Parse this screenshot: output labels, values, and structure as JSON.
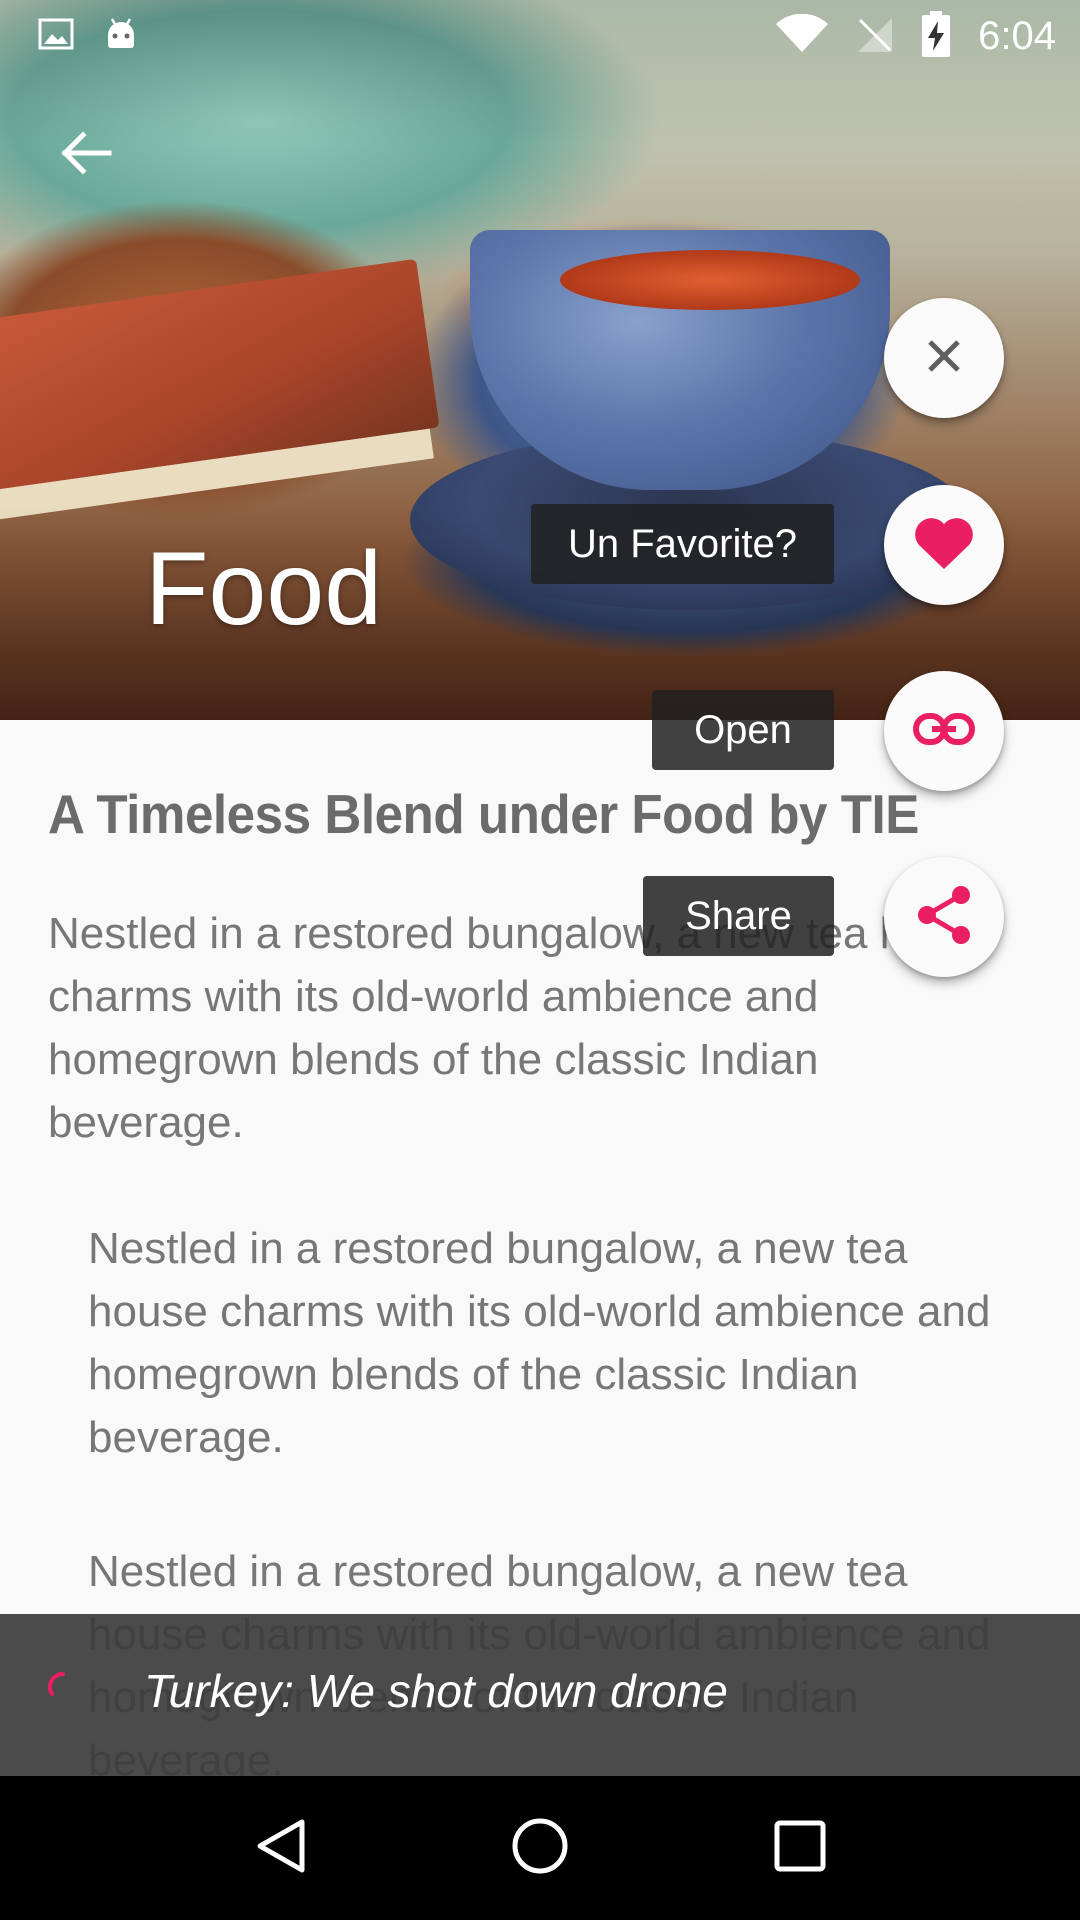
{
  "status_bar": {
    "time": "6:04",
    "icons": [
      "image-notification-icon",
      "android-notification-icon",
      "wifi-icon",
      "no-signal-icon",
      "battery-charging-icon"
    ]
  },
  "header": {
    "title": "Food",
    "back_icon": "arrow-back-icon"
  },
  "article": {
    "title": "A Timeless Blend under Food by TIE",
    "paragraphs": [
      "Nestled in a restored bungalow, a new tea house charms with its old-world ambience and homegrown blends of the classic Indian beverage.",
      "Nestled in a restored bungalow, a new tea house charms with its old-world ambience and homegrown blends of the classic Indian beverage.",
      "Nestled in a restored bungalow, a new tea house charms with its old-world ambience and homegrown blends of the classic Indian beverage."
    ]
  },
  "fab_menu": {
    "close_icon": "close-icon",
    "items": [
      {
        "label": "Un Favorite?",
        "icon": "heart-icon"
      },
      {
        "label": "Open",
        "icon": "link-icon"
      },
      {
        "label": "Share",
        "icon": "share-icon"
      }
    ]
  },
  "snackbar": {
    "text": "Turkey: We shot down drone"
  },
  "nav_bar": {
    "icons": [
      "back-triangle-icon",
      "home-circle-icon",
      "recents-square-icon"
    ]
  },
  "colors": {
    "accent": "#e91e63",
    "fab_background": "#fafafa",
    "snackbar_background": "#3c3c3c",
    "nav_background": "#000000"
  }
}
